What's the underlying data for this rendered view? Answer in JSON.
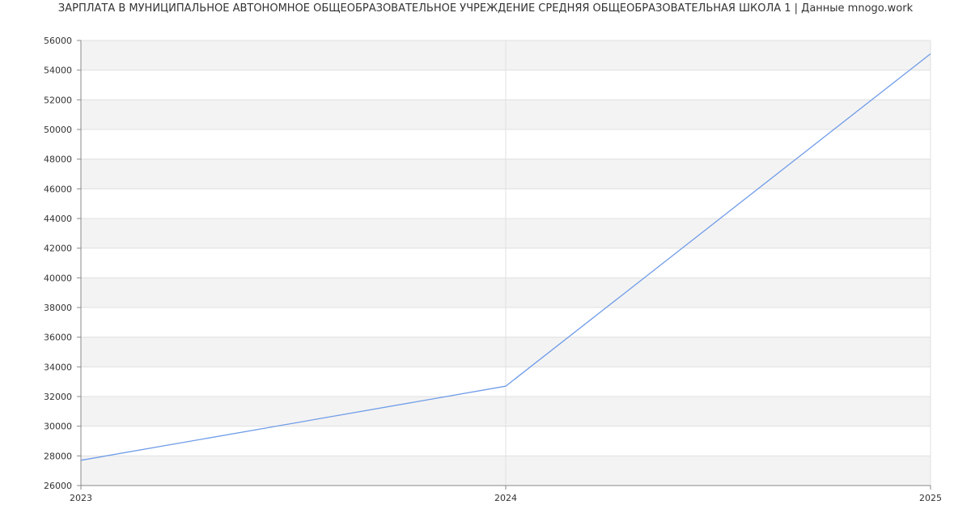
{
  "chart_data": {
    "type": "line",
    "title": "ЗАРПЛАТА В МУНИЦИПАЛЬНОЕ АВТОНОМНОЕ ОБЩЕОБРАЗОВАТЕЛЬНОЕ УЧРЕЖДЕНИЕ СРЕДНЯЯ ОБЩЕОБРАЗОВАТЕЛЬНАЯ ШКОЛА 1 | Данные mnogo.work",
    "xlabel": "",
    "ylabel": "",
    "x": [
      "2023",
      "2024",
      "2025"
    ],
    "series": [
      {
        "values": [
          27700,
          32700,
          55100
        ]
      }
    ],
    "ylim": [
      26000,
      56000
    ],
    "yticks": [
      "26000",
      "28000",
      "30000",
      "32000",
      "34000",
      "36000",
      "38000",
      "40000",
      "42000",
      "44000",
      "46000",
      "48000",
      "50000",
      "52000",
      "54000",
      "56000"
    ],
    "grid": true,
    "banded_background": true,
    "legend": "none",
    "colors": {
      "line": "#6f9ce8",
      "band": "#f3f3f3",
      "grid": "#e0e0e0",
      "axis": "#888888",
      "text": "#333333"
    }
  }
}
